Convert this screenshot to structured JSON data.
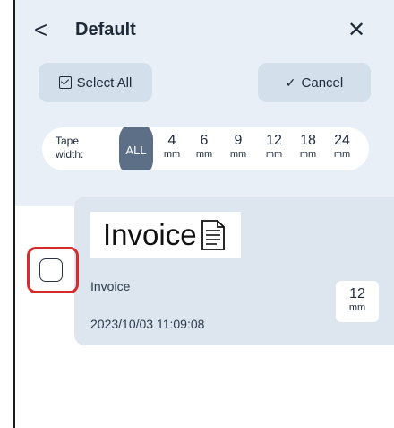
{
  "header": {
    "title": "Default",
    "back_glyph": "<",
    "close_glyph": "✕"
  },
  "toolbar": {
    "select_all_label": "Select All",
    "cancel_label": "Cancel",
    "cancel_glyph": "✓"
  },
  "tape_width": {
    "label_line1": "Tape",
    "label_line2": "width:",
    "selected": "ALL",
    "options": [
      {
        "n": "4",
        "u": "mm"
      },
      {
        "n": "6",
        "u": "mm"
      },
      {
        "n": "9",
        "u": "mm"
      },
      {
        "n": "12",
        "u": "mm"
      },
      {
        "n": "18",
        "u": "mm"
      },
      {
        "n": "24",
        "u": "mm"
      }
    ]
  },
  "items": [
    {
      "preview_text": "Invoice",
      "name": "Invoice",
      "date": "2023/10/03 11:09:08",
      "tape_size": "12",
      "tape_unit": "mm",
      "checked": false
    }
  ],
  "colors": {
    "header_bg": "#e9eff6",
    "button_bg": "#d3dfea",
    "selected_chip": "#5c6f86",
    "card_bg": "#dde6ef",
    "highlight": "#d62b2b"
  }
}
